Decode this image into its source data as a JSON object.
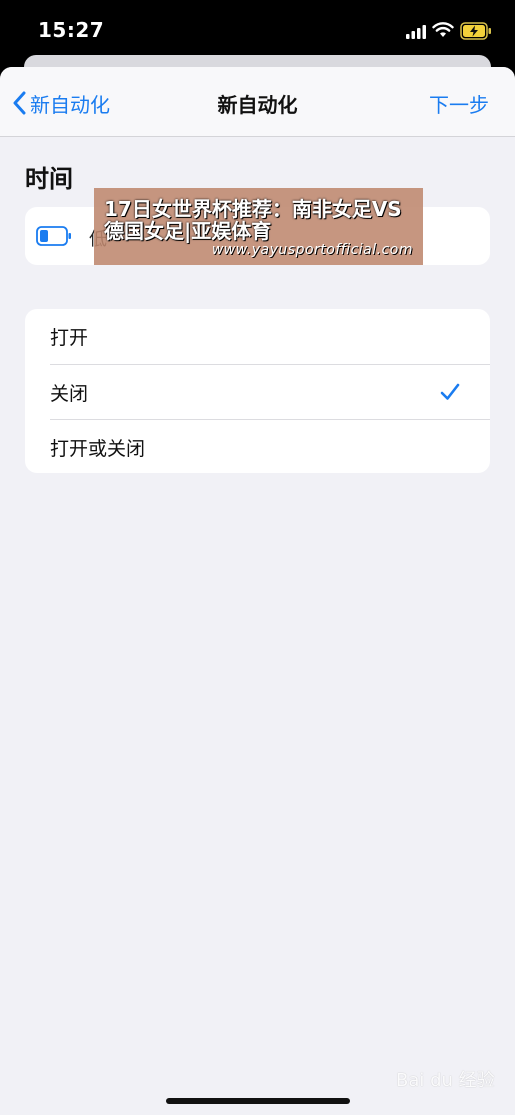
{
  "status_bar": {
    "time": "15:27",
    "icons": [
      "signal-icon",
      "wifi-icon",
      "battery-charging-icon"
    ]
  },
  "nav": {
    "back_label": "新自动化",
    "title": "新自动化",
    "next_label": "下一步"
  },
  "section": {
    "title": "时间"
  },
  "battery_row": {
    "label": "低",
    "icon": "battery-low-icon"
  },
  "options": [
    {
      "label": "打开",
      "selected": false
    },
    {
      "label": "关闭",
      "selected": true
    },
    {
      "label": "打开或关闭",
      "selected": false
    }
  ],
  "overlay": {
    "title": "17日女世界杯推荐：南非女足VS德国女足|亚娱体育",
    "url": "www.yayusportofficial.com"
  },
  "watermark": {
    "text": "Bai du 经验"
  },
  "colors": {
    "accent": "#1a7cf0",
    "background": "#f1f1f6",
    "card": "#ffffff"
  }
}
